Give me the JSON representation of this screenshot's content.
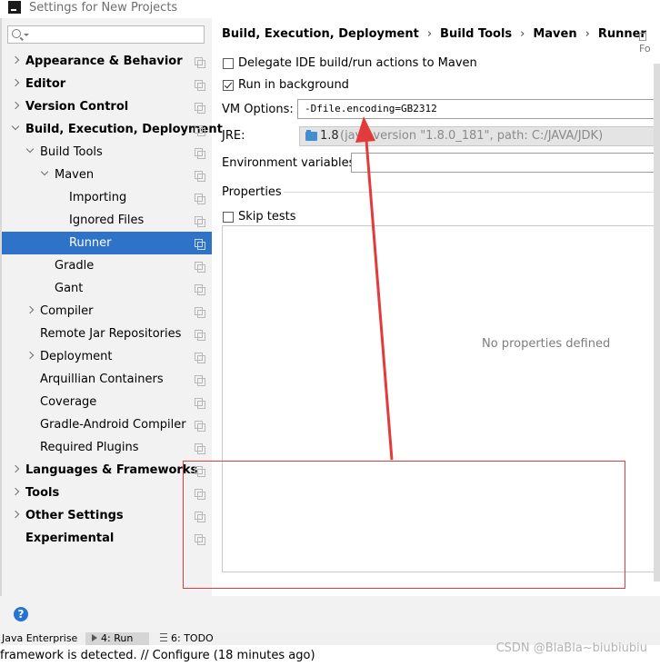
{
  "window": {
    "title": "Settings for New Projects"
  },
  "search": {
    "placeholder": ""
  },
  "tree": [
    {
      "label": "Appearance & Behavior",
      "bold": true,
      "expander": "collapsed",
      "level": 0
    },
    {
      "label": "Editor",
      "bold": true,
      "expander": "collapsed",
      "level": 0
    },
    {
      "label": "Version Control",
      "bold": true,
      "expander": "collapsed",
      "level": 0
    },
    {
      "label": "Build, Execution, Deployment",
      "bold": true,
      "expander": "expanded",
      "level": 0
    },
    {
      "label": "Build Tools",
      "bold": false,
      "expander": "expanded",
      "level": 1
    },
    {
      "label": "Maven",
      "bold": false,
      "expander": "expanded",
      "level": 2
    },
    {
      "label": "Importing",
      "bold": false,
      "expander": "none",
      "level": 3
    },
    {
      "label": "Ignored Files",
      "bold": false,
      "expander": "none",
      "level": 3
    },
    {
      "label": "Runner",
      "bold": false,
      "expander": "none",
      "level": 3,
      "selected": true
    },
    {
      "label": "Gradle",
      "bold": false,
      "expander": "none",
      "level": 2
    },
    {
      "label": "Gant",
      "bold": false,
      "expander": "none",
      "level": 2
    },
    {
      "label": "Compiler",
      "bold": false,
      "expander": "collapsed",
      "level": 1
    },
    {
      "label": "Remote Jar Repositories",
      "bold": false,
      "expander": "none",
      "level": 1
    },
    {
      "label": "Deployment",
      "bold": false,
      "expander": "collapsed",
      "level": 1
    },
    {
      "label": "Arquillian Containers",
      "bold": false,
      "expander": "none",
      "level": 1
    },
    {
      "label": "Coverage",
      "bold": false,
      "expander": "none",
      "level": 1
    },
    {
      "label": "Gradle-Android Compiler",
      "bold": false,
      "expander": "none",
      "level": 1
    },
    {
      "label": "Required Plugins",
      "bold": false,
      "expander": "none",
      "level": 1
    },
    {
      "label": "Languages & Frameworks",
      "bold": true,
      "expander": "collapsed",
      "level": 0
    },
    {
      "label": "Tools",
      "bold": true,
      "expander": "collapsed",
      "level": 0
    },
    {
      "label": "Other Settings",
      "bold": true,
      "expander": "collapsed",
      "level": 0
    },
    {
      "label": "Experimental",
      "bold": true,
      "expander": "none",
      "level": 0
    }
  ],
  "breadcrumb": {
    "items": [
      "Build, Execution, Deployment",
      "Build Tools",
      "Maven",
      "Runner"
    ],
    "separator": "›"
  },
  "header_extra": "Fo",
  "runner": {
    "delegate_label": "Delegate IDE build/run actions to Maven",
    "delegate_checked": false,
    "background_label": "Run in background",
    "background_checked": true,
    "vm_options_label": "VM Options:",
    "vm_options_value": "-Dfile.encoding=GB2312",
    "jre_label": "JRE:",
    "jre_version": "1.8",
    "jre_desc": "(java version \"1.8.0_181\", path: C:/JAVA/JDK)",
    "env_label": "Environment variables:",
    "env_value": "",
    "properties_label": "Properties",
    "skip_tests_label": "Skip tests",
    "skip_tests_checked": false,
    "no_properties_text": "No properties defined"
  },
  "footer": {
    "help_label": "?"
  },
  "toolwindows": [
    {
      "label": "Java Enterprise",
      "active": false,
      "icon": "none"
    },
    {
      "label": "4: Run",
      "active": true,
      "icon": "run-icon"
    },
    {
      "label": "6: TODO",
      "active": false,
      "icon": "todo-icon"
    }
  ],
  "status": {
    "text": "framework is detected. // Configure (18 minutes ago)"
  },
  "watermark": "CSDN @BlaBla~biubiubiu",
  "annotation": {
    "color": "#e23b3b"
  },
  "colors": {
    "selection": "#2e73c8",
    "help": "#2474d4",
    "panel": "#f2f2f2"
  }
}
